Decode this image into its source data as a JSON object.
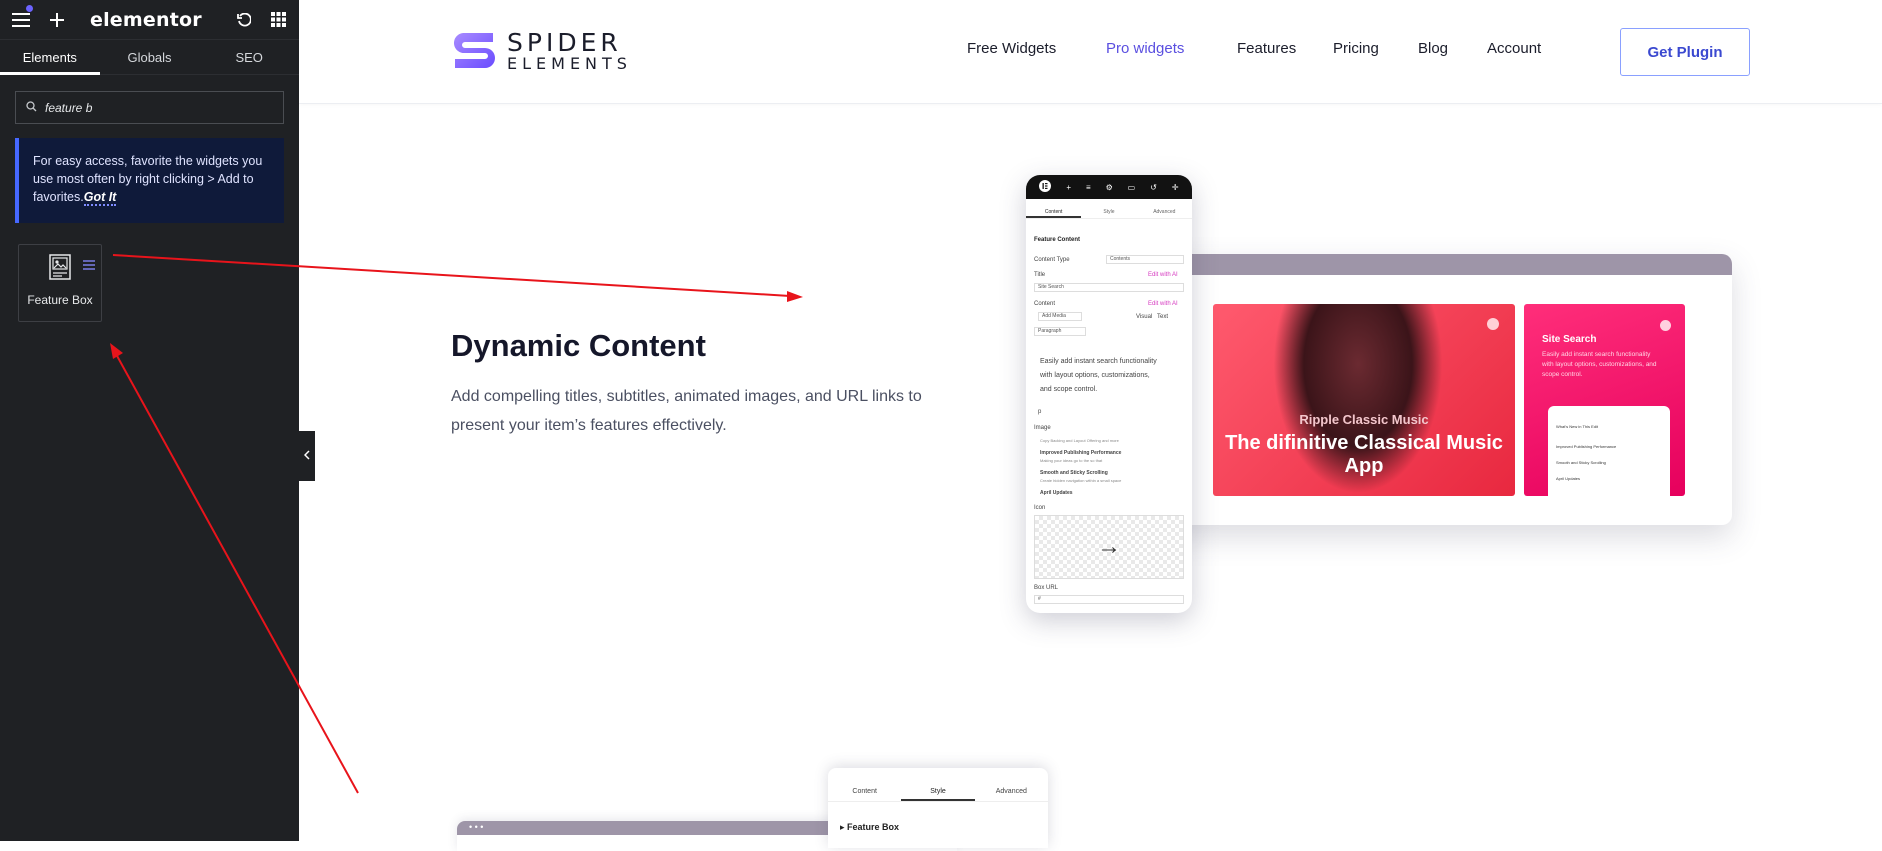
{
  "editor": {
    "logo": "elementor",
    "tabs": [
      "Elements",
      "Globals",
      "SEO"
    ],
    "search_value": "feature b",
    "notice_text": "For easy access, favorite the widgets you use most often by right clicking > Add to favorites.",
    "notice_link": "Got It",
    "widget_label": "Feature Box"
  },
  "site": {
    "brand_line1": "SPIDER",
    "brand_line2": "ELEMENTS",
    "nav": [
      "Free Widgets",
      "Pro widgets",
      "Features",
      "Pricing",
      "Blog",
      "Account"
    ],
    "cta": "Get Plugin",
    "colors": {
      "accent": "#5a4fe0",
      "cta_border": "#8aa0ff",
      "annotation": "#e8141b"
    }
  },
  "section": {
    "heading": "Dynamic Content",
    "description": "Add compelling titles, subtitles, animated images, and URL links to present your item’s features effectively."
  },
  "phone": {
    "tabs": [
      "Content",
      "Style",
      "Advanced"
    ],
    "section": "Feature Content",
    "content_type_label": "Content Type",
    "content_type_value": "Contents",
    "title_label": "Title",
    "ai_link": "Edit with AI",
    "title_value": "Site Search",
    "content_label": "Content",
    "add_media": "Add Media",
    "visual": "Visual",
    "text": "Text",
    "paragraph": "Paragraph",
    "editor_text_1": "Easily add instant search functionality",
    "editor_text_2": "with layout options, customizations,",
    "editor_text_3": "and scope control.",
    "editor_p": "p",
    "image_label": "Image",
    "list_1": "Copy Backing and Layout Offering and more",
    "list_2": "Improved Publishing Performance",
    "list_3": "Making your ideas go to the so that",
    "list_4": "Smooth and Sticky Scrolling",
    "list_5": "Create hidden navigation within a small space",
    "list_6": "April Updates",
    "icon_label": "Icon",
    "url_label": "Box URL",
    "url_value": "#"
  },
  "card1": {
    "subtitle": "Ripple Classic Music",
    "title": "The difinitive Classical Music App"
  },
  "card2": {
    "title": "Site Search",
    "text": "Easily add instant search functionality with layout options, customizations, and scope control.",
    "mini_1": "What's New in This Edit",
    "mini_2": "Improved Publishing Performance",
    "mini_3": "Smooth and Sticky Scrolling",
    "mini_4": "April Updates"
  },
  "panel2": {
    "tabs": [
      "Content",
      "Style",
      "Advanced"
    ],
    "section": "Feature Box"
  }
}
